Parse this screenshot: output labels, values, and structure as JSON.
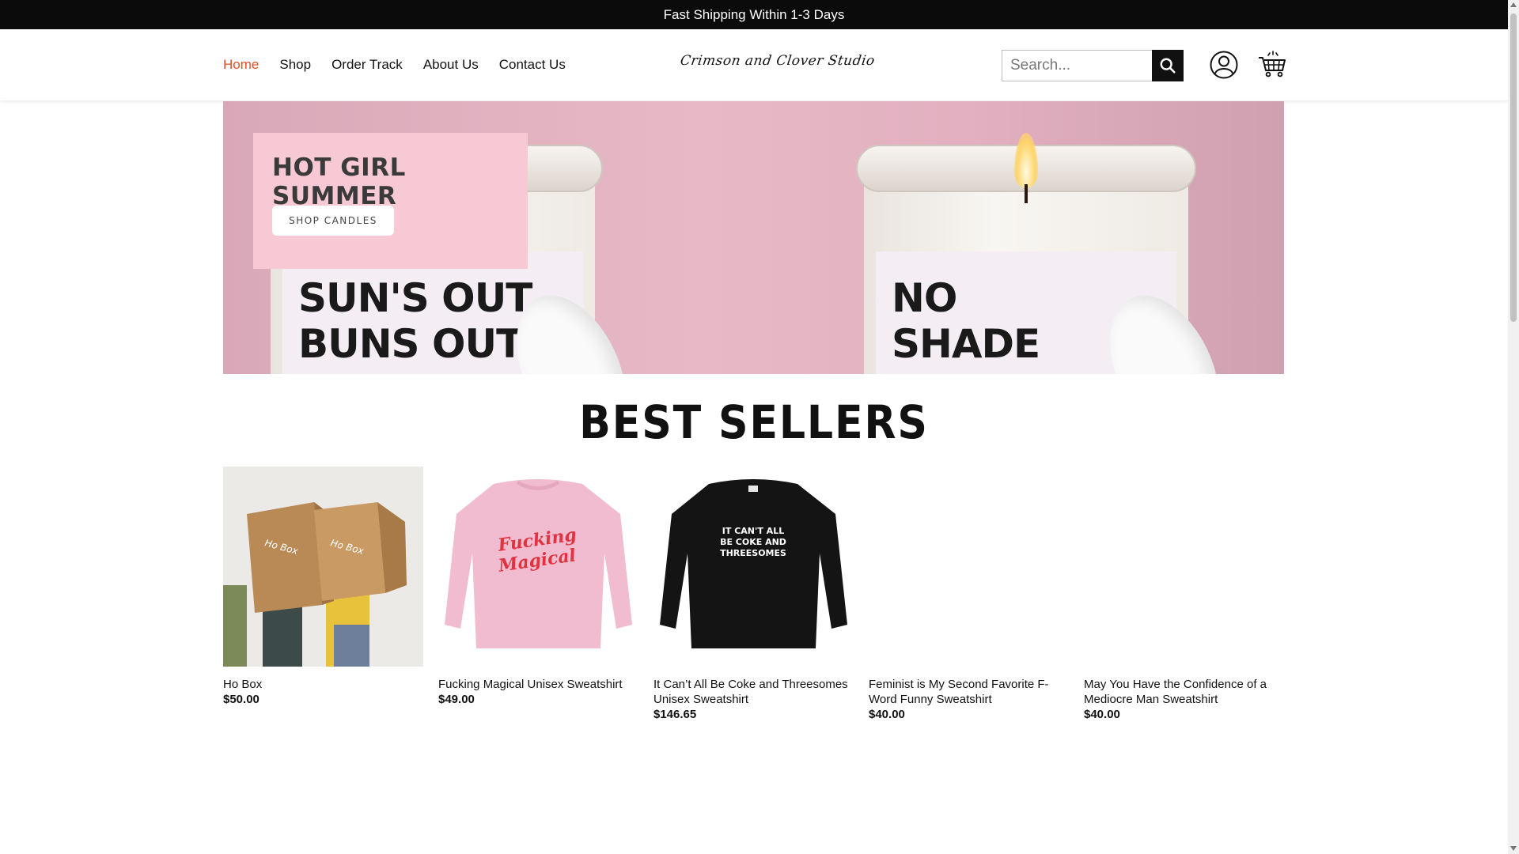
{
  "announcement": "Fast Shipping Within 1-3 Days",
  "nav": {
    "items": [
      {
        "label": "Home",
        "active": true
      },
      {
        "label": "Shop"
      },
      {
        "label": "Order Track"
      },
      {
        "label": "About Us"
      },
      {
        "label": "Contact Us"
      }
    ],
    "active_color": "#e3501f"
  },
  "brand": {
    "logo_text": "Crimson and Clover Studio"
  },
  "search": {
    "placeholder": "Search..."
  },
  "icons": {
    "search": "search-icon",
    "account": "user-icon",
    "cart": "cart-icon"
  },
  "hero": {
    "promo_title": "HOT GIRL SUMMER",
    "promo_button": "SHOP CANDLES",
    "jar_left_label": "SUN'S OUT BUNS OUT",
    "jar_right_label": "NO SHADE ALL TEA"
  },
  "best_sellers": {
    "title": "BEST SELLERS",
    "products": [
      {
        "name": "Ho Box",
        "price": "$50.00",
        "image": "ho-box-photo",
        "box_text": "Ho Box"
      },
      {
        "name": "Fucking Magical Unisex Sweatshirt",
        "price": "$49.00",
        "image": "pink-sweatshirt",
        "print": "Fucking Magical"
      },
      {
        "name": "It Can’t All Be Coke and Threesomes Unisex Sweatshirt",
        "price": "$146.65",
        "image": "black-sweatshirt",
        "print": "IT CAN'T ALL BE COKE AND THREESOMES"
      },
      {
        "name": "Feminist is My Second Favorite F-Word Funny Sweatshirt",
        "price": "$40.00",
        "image": "blank"
      },
      {
        "name": "May You Have the Confidence of a Mediocre Man Sweatshirt",
        "price": "$40.00",
        "image": "blank"
      }
    ]
  }
}
